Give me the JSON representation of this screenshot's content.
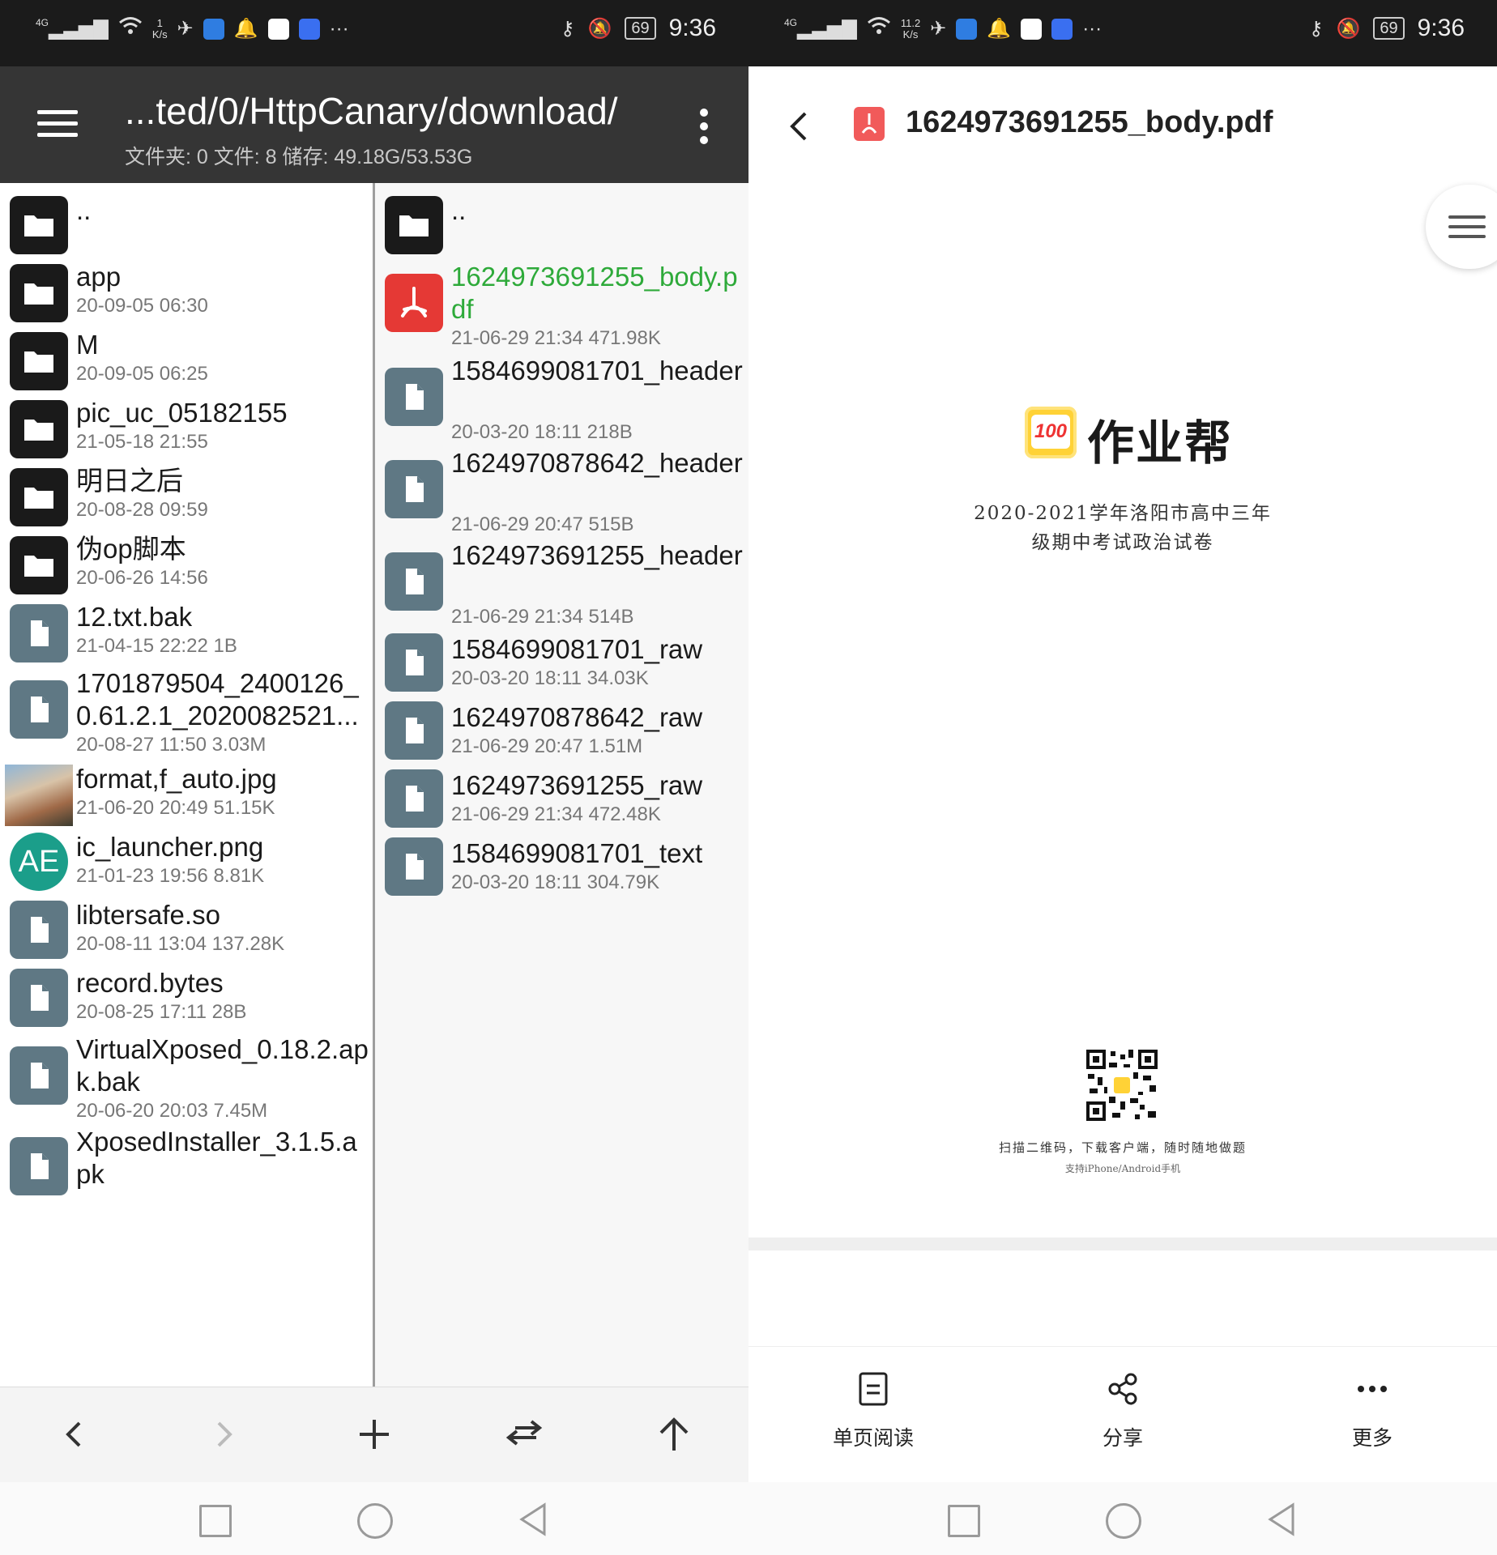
{
  "status_left": {
    "time": "9:36",
    "battery": "69",
    "net_speed_value": "1",
    "net_speed_unit": "K/s",
    "signal_label": "4G",
    "more": "···"
  },
  "status_right": {
    "time": "9:36",
    "battery": "69",
    "net_speed_value": "11.2",
    "net_speed_unit": "K/s",
    "signal_label": "4G",
    "more": "···"
  },
  "file_manager": {
    "path": "...ted/0/HttpCanary/download/",
    "summary": "文件夹: 0   文件: 8   储存: 49.18G/53.53G",
    "left_pane": [
      {
        "name": "..",
        "meta": "",
        "icon": "folder-icon"
      },
      {
        "name": "app",
        "meta": "20-09-05 06:30",
        "icon": "folder-icon"
      },
      {
        "name": "M",
        "meta": "20-09-05 06:25",
        "icon": "folder-icon"
      },
      {
        "name": "pic_uc_05182155",
        "meta": "21-05-18 21:55",
        "icon": "folder-icon"
      },
      {
        "name": "明日之后",
        "meta": "20-08-28 09:59",
        "icon": "folder-icon"
      },
      {
        "name": "伪op脚本",
        "meta": "20-06-26 14:56",
        "icon": "folder-icon"
      },
      {
        "name": "12.txt.bak",
        "meta": "21-04-15 22:22  1B",
        "icon": "file-icon"
      },
      {
        "name": "1701879504_2400126_0.61.2.1_2020082521...",
        "meta": "20-08-27 11:50  3.03M",
        "icon": "file-icon"
      },
      {
        "name": "format,f_auto.jpg",
        "meta": "21-06-20 20:49  51.15K",
        "icon": "image-thumbnail"
      },
      {
        "name": "ic_launcher.png",
        "meta": "21-01-23 19:56  8.81K",
        "icon": "app-avatar-icon",
        "avatar_text": "AE"
      },
      {
        "name": "libtersafe.so",
        "meta": "20-08-11 13:04  137.28K",
        "icon": "file-icon"
      },
      {
        "name": "record.bytes",
        "meta": "20-08-25 17:11  28B",
        "icon": "file-icon"
      },
      {
        "name": "VirtualXposed_0.18.2.apk.bak",
        "meta": "20-06-20 20:03  7.45M",
        "icon": "file-icon"
      },
      {
        "name": "XposedInstaller_3.1.5.apk",
        "meta": "",
        "icon": "file-icon"
      }
    ],
    "right_pane": [
      {
        "name": "..",
        "meta": "",
        "icon": "folder-icon"
      },
      {
        "name": "1624973691255_body.pdf",
        "meta": "21-06-29 21:34  471.98K",
        "icon": "pdf-icon",
        "selected": true
      },
      {
        "name": "1584699081701_header",
        "meta": "20-03-20 18:11  218B",
        "icon": "file-icon"
      },
      {
        "name": "1624970878642_header",
        "meta": "21-06-29 20:47  515B",
        "icon": "file-icon"
      },
      {
        "name": "1624973691255_header",
        "meta": "21-06-29 21:34  514B",
        "icon": "file-icon"
      },
      {
        "name": "1584699081701_raw",
        "meta": "20-03-20 18:11  34.03K",
        "icon": "file-icon"
      },
      {
        "name": "1624970878642_raw",
        "meta": "21-06-29 20:47  1.51M",
        "icon": "file-icon"
      },
      {
        "name": "1624973691255_raw",
        "meta": "21-06-29 21:34  472.48K",
        "icon": "file-icon"
      },
      {
        "name": "1584699081701_text",
        "meta": "20-03-20 18:11  304.79K",
        "icon": "file-icon"
      }
    ],
    "toolbar_icons": [
      "back-arrow-icon",
      "forward-arrow-icon",
      "plus-icon",
      "swap-icon",
      "up-arrow-icon"
    ]
  },
  "pdf_viewer": {
    "title": "1624973691255_body.pdf",
    "brand_logo_text": "100",
    "brand_name": "作业帮",
    "doc_title_line1": "2020-2021学年洛阳市高中三年",
    "doc_title_line2": "级期中考试政治试卷",
    "qr_caption": "扫描二维码，下载客户端，随时随地做题",
    "qr_subcaption": "支持iPhone/Android手机",
    "actions": {
      "single_page": "单页阅读",
      "share": "分享",
      "more": "更多"
    }
  },
  "colors": {
    "header_bg": "#353535",
    "selected_file": "#2eaa3a",
    "pdf_red": "#e53935",
    "file_icon": "#5f7884"
  }
}
